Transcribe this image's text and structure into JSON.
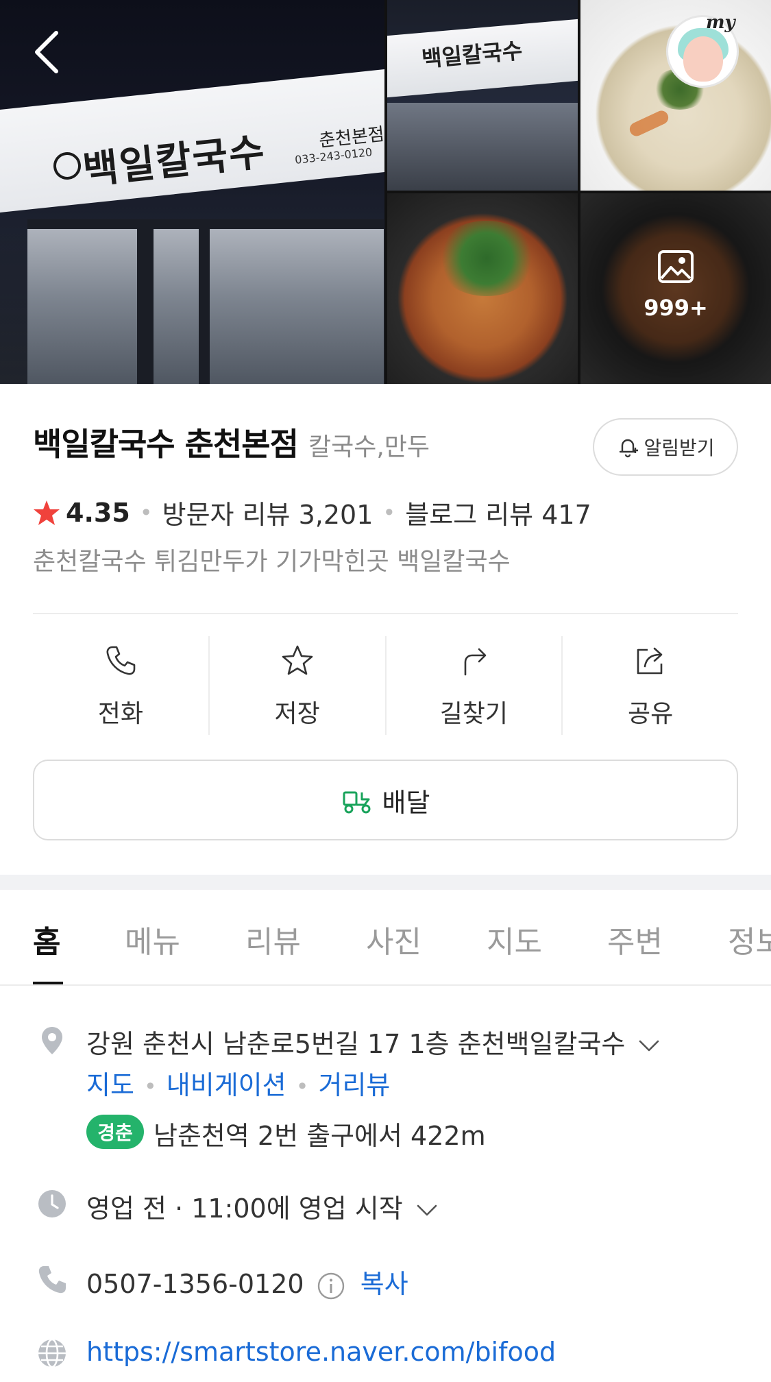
{
  "gallery": {
    "sign_text": "백일칼국수",
    "sign_branch": "춘천본점",
    "sign_phone": "033-243-0120",
    "more_count": "999+",
    "my_label": "my"
  },
  "place": {
    "name": "백일칼국수 춘천본점",
    "category": "칼국수,만두",
    "alert_label": "알림받기",
    "rating": "4.35",
    "visitor_reviews": "방문자 리뷰 3,201",
    "blog_reviews": "블로그 리뷰 417",
    "tagline": "춘천칼국수 튀김만두가 기가막힌곳 백일칼국수",
    "colors": {
      "star": "#f0423c",
      "link": "#1a6bd6",
      "subway": "#24b36b",
      "delivery": "#19a35b"
    }
  },
  "actions": [
    {
      "label": "전화",
      "icon": "phone-icon"
    },
    {
      "label": "저장",
      "icon": "star-icon"
    },
    {
      "label": "길찾기",
      "icon": "directions-icon"
    },
    {
      "label": "공유",
      "icon": "share-icon"
    }
  ],
  "delivery": {
    "label": "배달",
    "icon": "delivery-scooter-icon"
  },
  "tabs": [
    "홈",
    "메뉴",
    "리뷰",
    "사진",
    "지도",
    "주변",
    "정보"
  ],
  "info": {
    "address": "강원 춘천시 남춘로5번길 17 1층 춘천백일칼국수",
    "links": [
      "지도",
      "내비게이션",
      "거리뷰"
    ],
    "subway_line": "경춘",
    "subway_text": "남춘천역 2번 출구에서 422m",
    "hours": "영업 전 · 11:00에 영업 시작",
    "phone": "0507-1356-0120",
    "copy_label": "복사",
    "website": "https://smartstore.naver.com/bifood"
  }
}
